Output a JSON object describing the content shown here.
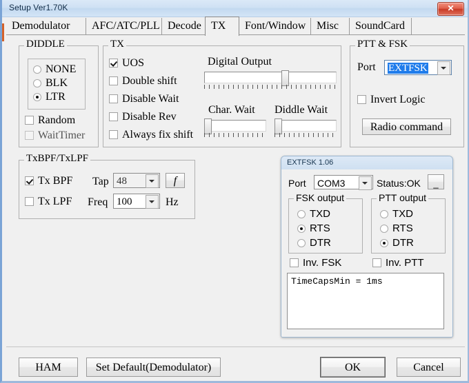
{
  "window": {
    "title": "Setup Ver1.70K",
    "close_label": "✕",
    "close_icon": "close-icon"
  },
  "tabs": [
    {
      "label": "Demodulator",
      "active": false
    },
    {
      "label": "AFC/ATC/PLL",
      "active": false
    },
    {
      "label": "Decode",
      "active": false
    },
    {
      "label": "TX",
      "active": true
    },
    {
      "label": "Font/Window",
      "active": false
    },
    {
      "label": "Misc",
      "active": false
    },
    {
      "label": "SoundCard",
      "active": false
    }
  ],
  "diddle": {
    "legend": "DIDDLE",
    "radios": [
      {
        "label": "NONE",
        "selected": false
      },
      {
        "label": "BLK",
        "selected": false
      },
      {
        "label": "LTR",
        "selected": true
      }
    ],
    "checks": [
      {
        "label": "Random",
        "checked": false,
        "enabled": true
      },
      {
        "label": "WaitTimer",
        "checked": false,
        "enabled": false
      }
    ]
  },
  "tx": {
    "legend": "TX",
    "checks": [
      {
        "label": "UOS",
        "checked": true
      },
      {
        "label": "Double shift",
        "checked": false
      },
      {
        "label": "Disable Wait",
        "checked": false
      },
      {
        "label": "Disable Rev",
        "checked": false
      },
      {
        "label": "Always fix shift",
        "checked": false
      }
    ],
    "digital_output_label": "Digital Output",
    "char_wait_label": "Char. Wait",
    "diddle_wait_label": "Diddle Wait"
  },
  "ptt_fsk": {
    "legend": "PTT & FSK",
    "port_label": "Port",
    "port_value": "EXTFSK",
    "invert_logic_label": "Invert Logic",
    "invert_logic_checked": false,
    "radio_command_label": "Radio command"
  },
  "txbpf": {
    "legend": "TxBPF/TxLPF",
    "tx_bpf_label": "Tx BPF",
    "tx_bpf_checked": true,
    "tx_lpf_label": "Tx LPF",
    "tx_lpf_checked": false,
    "tap_label": "Tap",
    "tap_value": "48",
    "f_button_label": "f",
    "freq_label": "Freq",
    "freq_value": "100",
    "hz_label": "Hz"
  },
  "extfsk": {
    "title": "EXTFSK 1.06",
    "minimize_label": "_",
    "port_label": "Port",
    "port_value": "COM3",
    "status_label": "Status:OK",
    "fsk_output": {
      "legend": "FSK output",
      "radios": [
        {
          "label": "TXD",
          "selected": false
        },
        {
          "label": "RTS",
          "selected": true
        },
        {
          "label": "DTR",
          "selected": false
        }
      ]
    },
    "ptt_output": {
      "legend": "PTT output",
      "radios": [
        {
          "label": "TXD",
          "selected": false
        },
        {
          "label": "RTS",
          "selected": false
        },
        {
          "label": "DTR",
          "selected": true
        }
      ]
    },
    "inv_fsk_label": "Inv. FSK",
    "inv_fsk_checked": false,
    "inv_ptt_label": "Inv. PTT",
    "inv_ptt_checked": false,
    "log_text": "TimeCapsMin = 1ms"
  },
  "footer": {
    "ham_label": "HAM",
    "set_default_label": "Set Default(Demodulator)",
    "ok_label": "OK",
    "cancel_label": "Cancel"
  },
  "colors": {
    "background": "#f0f0f0",
    "title_bar": "#cfe1f4",
    "close_button": "#c83a26",
    "selection_blue": "#1f7ceb"
  }
}
